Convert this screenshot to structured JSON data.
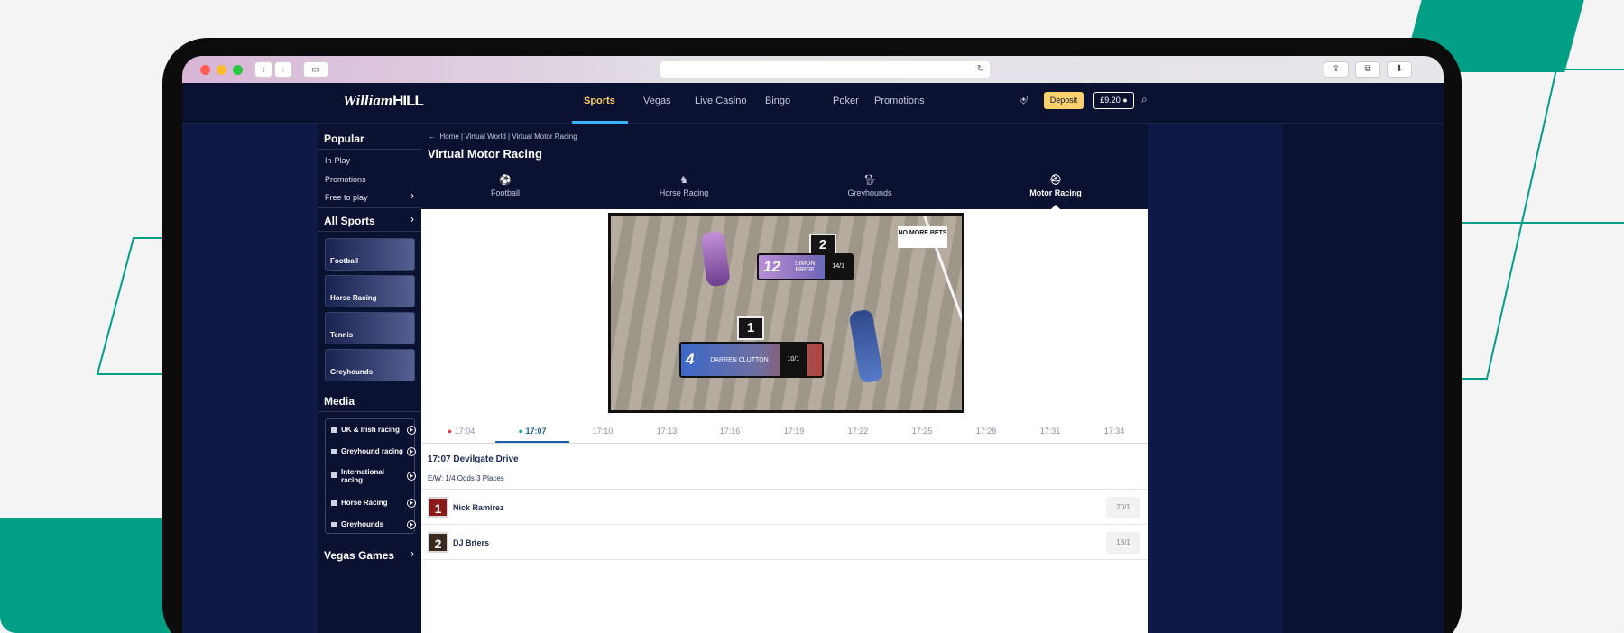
{
  "nav": {
    "logo_script": "William",
    "logo_bold": "HILL",
    "items": [
      "Sports",
      "Vegas",
      "Live Casino",
      "Bingo",
      "Poker",
      "Promotions"
    ],
    "active": "Sports",
    "deposit": "Deposit",
    "balance": "£9.20"
  },
  "sidebar": {
    "popular_heading": "Popular",
    "popular": [
      "In-Play",
      "Promotions",
      "Free to play"
    ],
    "all_sports": "All Sports",
    "sports_cards": [
      "Football",
      "Horse Racing",
      "Tennis",
      "Greyhounds"
    ],
    "media_heading": "Media",
    "media": [
      "UK & Irish racing",
      "Greyhound racing",
      "International racing",
      "Horse Racing",
      "Greyhounds"
    ],
    "vegas_games": "Vegas Games"
  },
  "main": {
    "breadcrumb": "Home | Virtual World | Virtual Motor Racing",
    "title": "Virtual Motor Racing",
    "sport_tabs": [
      "Football",
      "Horse Racing",
      "Greyhounds",
      "Motor Racing"
    ],
    "active_tab": "Motor Racing"
  },
  "video": {
    "no_more_bets": "NO MORE BETS",
    "board1": {
      "position": "2",
      "number": "12",
      "name": "SIMON BRIDE",
      "odds": "14/1"
    },
    "board2": {
      "position": "1",
      "number": "4",
      "name": "DARREN CLUTTON",
      "odds": "10/1"
    }
  },
  "times": [
    "17:04",
    "17:07",
    "17:10",
    "17:13",
    "17:16",
    "17:19",
    "17:22",
    "17:25",
    "17:28",
    "17:31",
    "17:34"
  ],
  "active_time": "17:07",
  "race": {
    "title": "17:07 Devilgate Drive",
    "ew": "E/W: 1/4 Odds 3 Places",
    "runners": [
      {
        "num": "1",
        "name": "Nick Ramirez",
        "odds": "20/1",
        "color": "#8b1a1a"
      },
      {
        "num": "2",
        "name": "DJ Briers",
        "odds": "18/1",
        "color": "#3a2a1f"
      }
    ]
  },
  "colors": {
    "brand_dark": "#0b1131",
    "accent_yellow": "#fcd06b",
    "accent_blue": "#1a5fa8",
    "teal": "#01a086"
  }
}
